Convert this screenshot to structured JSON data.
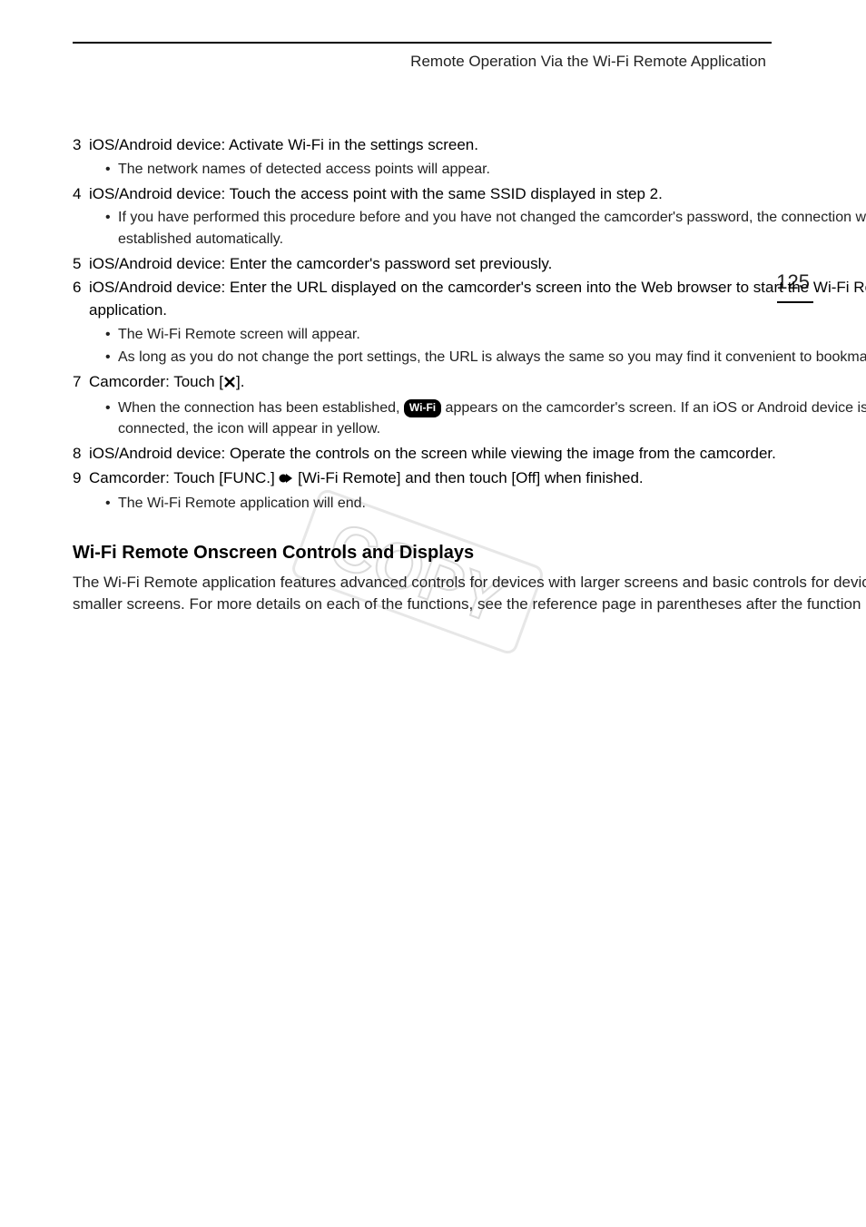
{
  "header": {
    "title": "Remote Operation Via the Wi-Fi Remote Application",
    "page_number": "125"
  },
  "steps": [
    {
      "num": "3",
      "text": "iOS/Android device: Activate Wi-Fi in the settings screen.",
      "subs": [
        "The network names of detected access points will appear."
      ]
    },
    {
      "num": "4",
      "text": "iOS/Android device: Touch the access point with the same SSID displayed in step 2.",
      "subs": [
        "If you have performed this procedure before and you have not changed the camcorder's password, the connection will be established automatically."
      ]
    },
    {
      "num": "5",
      "text": "iOS/Android device: Enter the camcorder's password set previously.",
      "subs": []
    },
    {
      "num": "6",
      "text": "iOS/Android device: Enter the URL displayed on the camcorder's screen into the Web browser to start the Wi-Fi Remote application.",
      "subs": [
        "The Wi-Fi Remote screen will appear.",
        "As long as you do not change the port settings, the URL is always the same so you may find it convenient to bookmark it."
      ]
    },
    {
      "num": "7",
      "text_before": "Camcorder: Touch [",
      "text_after": "].",
      "icon": "close-x",
      "subs_rich": [
        {
          "before": "When the connection has been established, ",
          "badge": "Wi-Fi",
          "after": " appears on the camcorder's screen. If an iOS or Android device is not connected, the icon will appear in yellow."
        }
      ]
    },
    {
      "num": "8",
      "text": "iOS/Android device: Operate the controls on the screen while viewing the image from the camcorder.",
      "subs": []
    },
    {
      "num": "9",
      "text_before": "Camcorder: Touch [FUNC.] ",
      "text_after": " [Wi-Fi Remote] and then touch [Off] when finished.",
      "icon": "proceed-arrow",
      "subs": [
        "The Wi-Fi Remote application will end."
      ]
    }
  ],
  "section": {
    "heading": "Wi-Fi Remote Onscreen Controls and Displays",
    "body": "The Wi-Fi Remote application features advanced controls for devices with larger screens and basic controls for devices with smaller screens. For more details on each of the functions, see the reference page in parentheses after the function name."
  },
  "watermark": "COPY"
}
